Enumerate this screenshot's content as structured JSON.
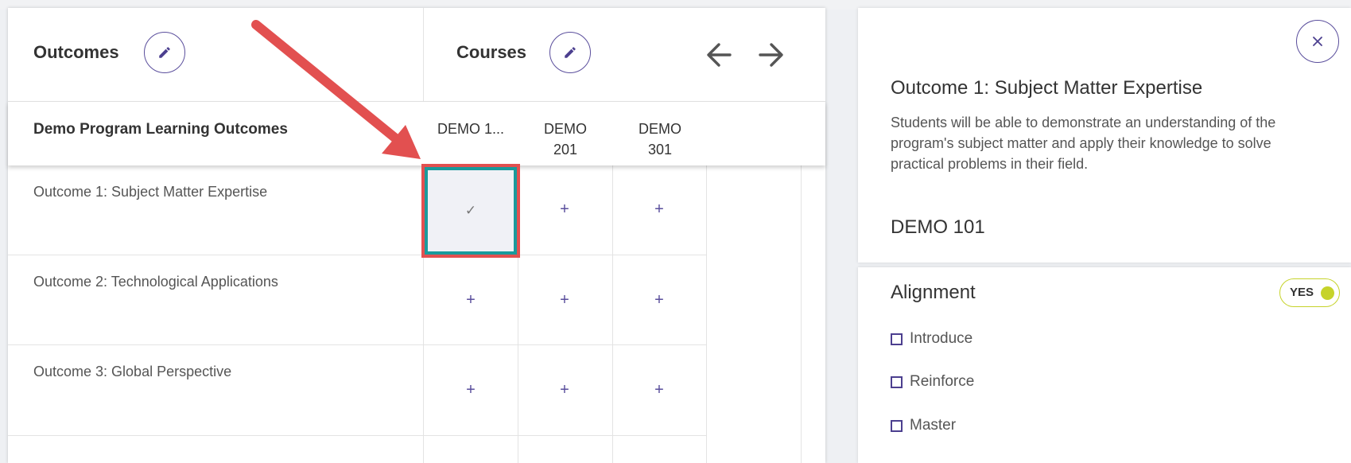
{
  "matrix": {
    "outcomes_header": "Outcomes",
    "courses_header": "Courses",
    "program_title": "Demo Program Learning Outcomes",
    "columns": [
      "DEMO 1...",
      "DEMO 201",
      "DEMO 301"
    ],
    "column_lines": [
      [
        "DEMO 1..."
      ],
      [
        "DEMO",
        "201"
      ],
      [
        "DEMO",
        "301"
      ]
    ],
    "rows": [
      "Outcome 1: Subject Matter Expertise",
      "Outcome 2: Technological Applications",
      "Outcome 3: Global Perspective"
    ],
    "cell_symbols": {
      "aligned": "✓",
      "empty": "+"
    }
  },
  "detail": {
    "title": "Outcome 1: Subject Matter Expertise",
    "description": "Students will be able to demonstrate an understanding of the program's subject matter and apply their knowledge to solve practical problems in their field.",
    "course": "DEMO 101",
    "alignment_title": "Alignment",
    "toggle_label": "YES",
    "options": [
      "Introduce",
      "Reinforce",
      "Master"
    ]
  },
  "colors": {
    "accent_purple": "#5a4e9c",
    "selected_border_teal": "#1a9a9c",
    "callout_red": "#e25050",
    "toggle_green": "#c6d32a"
  },
  "icons": {
    "edit": "pencil-icon",
    "prev": "arrow-left-icon",
    "next": "arrow-right-icon",
    "close": "close-icon"
  }
}
